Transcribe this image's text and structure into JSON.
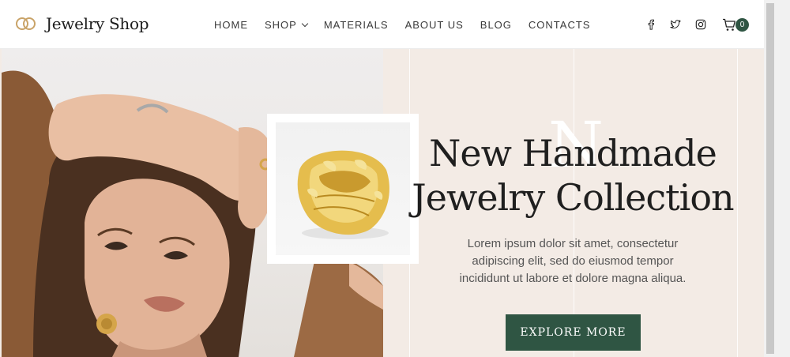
{
  "brand": {
    "name": "Jewelry Shop",
    "logo_icon": "interlocked-rings-icon",
    "accent": "#c9a368"
  },
  "nav": {
    "items": [
      {
        "label": "HOME"
      },
      {
        "label": "SHOP",
        "icon": "chevron-down-icon"
      },
      {
        "label": "MATERIALS"
      },
      {
        "label": "ABOUT US"
      },
      {
        "label": "BLOG"
      },
      {
        "label": "CONTACTS"
      }
    ]
  },
  "social": [
    {
      "name": "facebook-icon"
    },
    {
      "name": "twitter-icon"
    },
    {
      "name": "instagram-icon"
    }
  ],
  "cart": {
    "icon": "cart-icon",
    "count": "0",
    "badge_color": "#2f5543"
  },
  "hero": {
    "decor_letter": "N",
    "title_line1": "New Handmade",
    "title_line2": "Jewelry Collection",
    "description": "Lorem ipsum dolor sit amet, consectetur adipiscing elit, sed do eiusmod tempor incididunt ut labore et dolore magna aliqua.",
    "button_label": "EXPLORE MORE",
    "background": "#f3ebe5",
    "button_color": "#2f5543"
  }
}
